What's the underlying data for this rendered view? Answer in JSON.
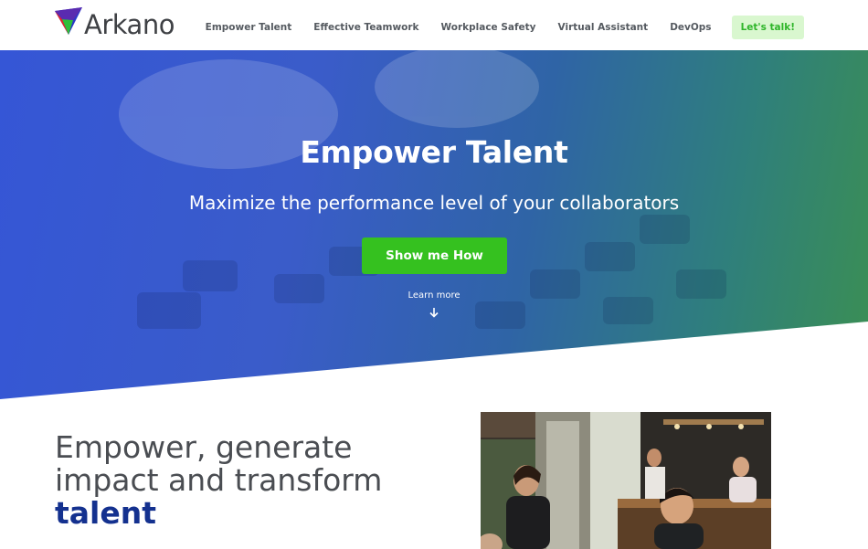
{
  "brand": {
    "name": "Arkano"
  },
  "nav": {
    "items": [
      {
        "label": "Empower Talent"
      },
      {
        "label": "Effective Teamwork"
      },
      {
        "label": "Workplace Safety"
      },
      {
        "label": "Virtual Assistant"
      },
      {
        "label": "DevOps"
      }
    ],
    "cta_label": "Let's talk!"
  },
  "hero": {
    "title": "Empower Talent",
    "subtitle": "Maximize the performance level of your collaborators",
    "button_label": "Show me How",
    "learn_more": "Learn more",
    "arrow_icon": "arrow-down-icon"
  },
  "section": {
    "heading_line1": "Empower, generate",
    "heading_line2": "impact and transform",
    "heading_accent": "talent"
  },
  "colors": {
    "accent_green": "#35c11f",
    "cta_bg": "#d9f7cf",
    "heading_accent": "#14318f",
    "hero_blue": "#3556d6",
    "hero_green": "#3b8f53"
  }
}
